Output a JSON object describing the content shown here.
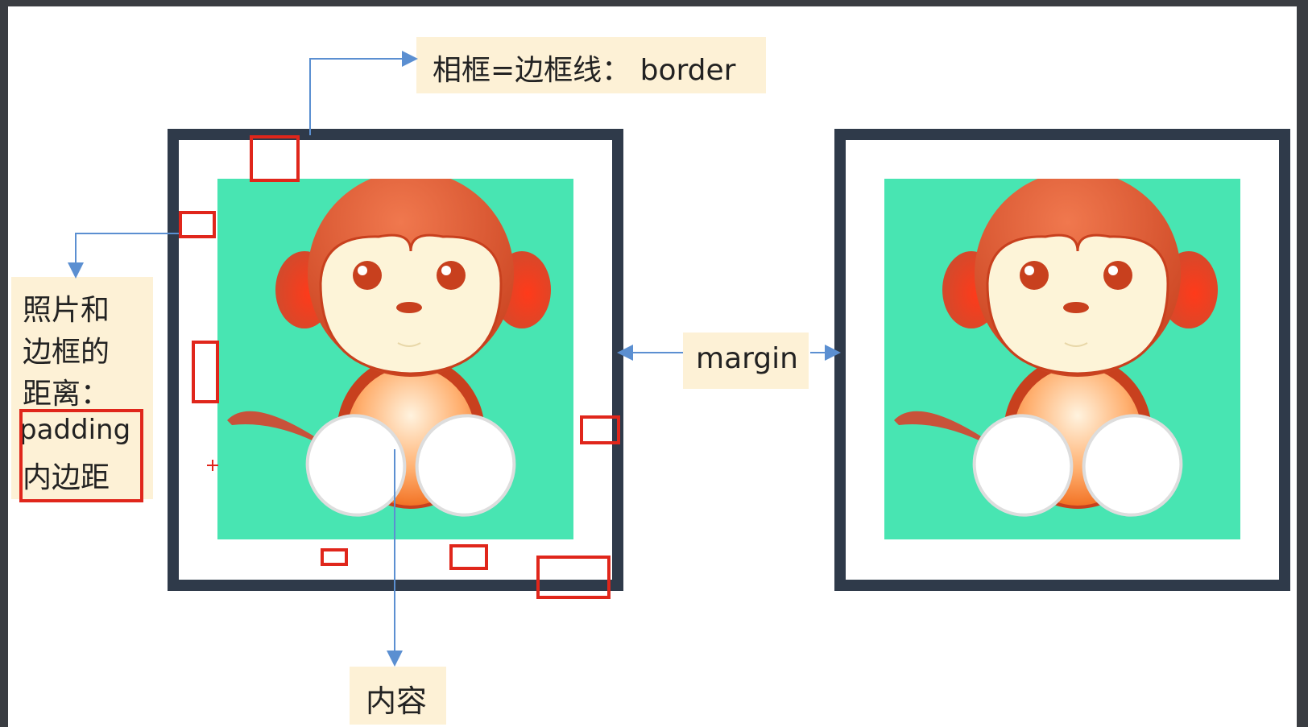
{
  "colors": {
    "frame": "#2f3a4a",
    "picture_background": "#48e5b2",
    "callout_background": "#fdf1d6",
    "arrow": "#5b8fd1",
    "marker": "#e0261b"
  },
  "labels": {
    "border": "相框=边框线： border",
    "padding_line1": "照片和",
    "padding_line2": "边框的",
    "padding_line3": "距离：",
    "padding_en": "padding",
    "padding_cn": "内边距",
    "margin": "margin",
    "content": "内容"
  },
  "images": {
    "left": "monkey-cartoon-icon",
    "right": "monkey-cartoon-icon"
  }
}
